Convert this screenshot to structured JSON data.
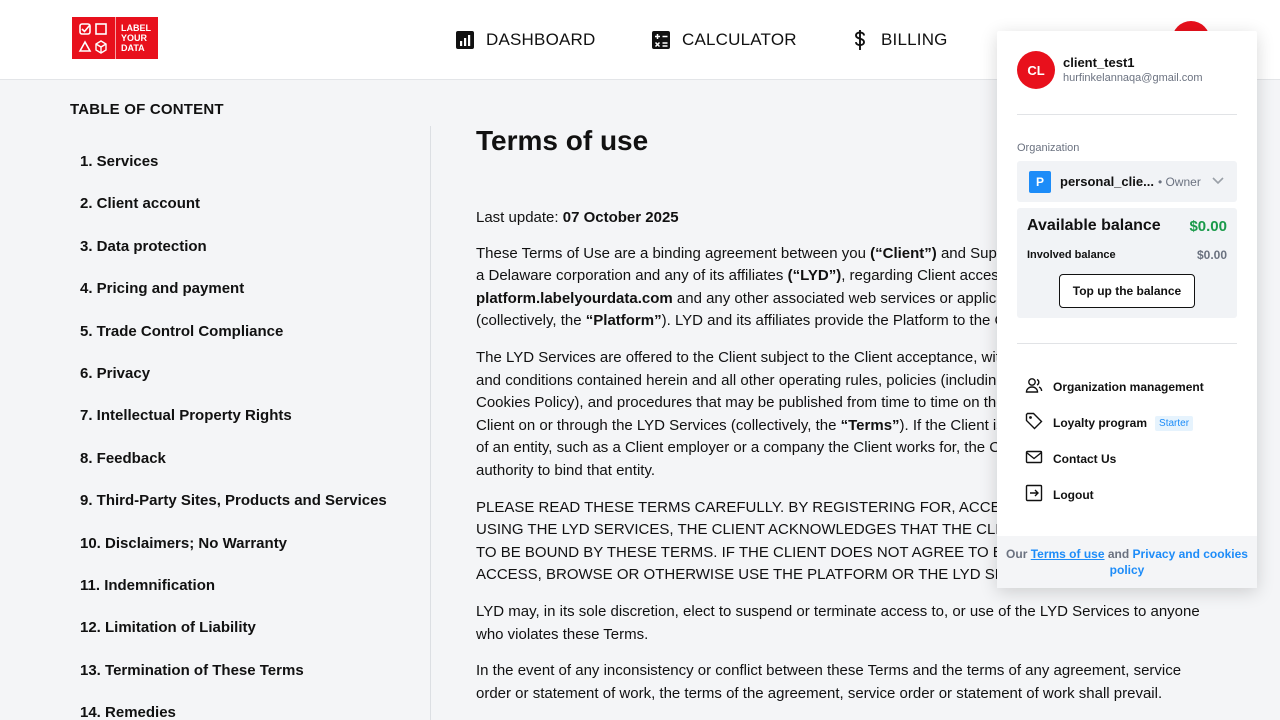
{
  "header": {
    "logo_text": [
      "LABEL",
      "YOUR",
      "DATA"
    ],
    "nav": [
      {
        "label": "DASHBOARD",
        "icon": "bar-chart-icon"
      },
      {
        "label": "CALCULATOR",
        "icon": "calculator-icon"
      },
      {
        "label": "BILLING",
        "icon": "dollar-icon"
      }
    ],
    "brand_color": "#e8101c"
  },
  "toc": {
    "title": "TABLE OF CONTENT",
    "items": [
      "1. Services",
      "2. Client account",
      "3. Data protection",
      "4. Pricing and payment",
      "5. Trade Control Compliance",
      "6. Privacy",
      "7. Intellectual Property Rights",
      "8. Feedback",
      "9. Third-Party Sites, Products and Services",
      "10. Disclaimers; No Warranty",
      "11. Indemnification",
      "12. Limitation of Liability",
      "13. Termination of These Terms",
      "14. Remedies"
    ]
  },
  "main": {
    "title": "Terms of use",
    "last_update_label": "Last update: ",
    "last_update_value": "07 October 2025",
    "p1": {
      "a": "These Terms of Use are a binding agreement between you ",
      "b": "(“Client”)",
      "c": " and SupportYo",
      "d": "a Delaware corporation and any of its affiliates ",
      "e": "(“LYD”)",
      "f": ", regarding Client access to a",
      "g": "platform.labelyourdata.com",
      "h": " and any other associated web services or applications",
      "i": "(collectively, the ",
      "j": "“Platform”",
      "k": "). LYD and its affiliates provide the Platform to the Clien"
    },
    "p2": {
      "a": "The LYD Services are offered to the Client subject to the Client acceptance, without",
      "b": "and conditions contained herein and all other operating rules, policies (including, w",
      "c": "Cookies Policy), and procedures that may be published from time to time on the Pla",
      "d": "Client on or through the LYD Services (collectively, the ",
      "e": "“Terms”",
      "f": "). If the Client is ente",
      "g": "of an entity, such as a Client employer or a company the Client works for, the Client",
      "h": "authority to bind that entity."
    },
    "p3": [
      "PLEASE READ THESE TERMS CAREFULLY. BY REGISTERING FOR, ACCESSING, BROW",
      "USING THE LYD SERVICES, THE CLIENT ACKNOWLEDGES THAT THE CLIENT HAS R",
      "TO BE BOUND BY THESE TERMS. IF THE CLIENT DOES NOT AGREE TO BE BOUND B",
      "ACCESS, BROWSE OR OTHERWISE USE THE PLATFORM OR THE LYD SERVICES."
    ],
    "p4": "LYD may, in its sole discretion, elect to suspend or terminate access to, or use of the LYD Services to anyone who violates these Terms.",
    "p5": "In the event of any inconsistency or conflict between these Terms and the terms of any agreement, service order or statement of work, the terms of the agreement, service order or statement of work shall prevail."
  },
  "dropdown": {
    "avatar_initials": "CL",
    "user_name": "client_test1",
    "user_email": "hurfinkelannaqa@gmail.com",
    "org_label": "Organization",
    "org_badge": "P",
    "org_name": "personal_clie...",
    "org_role": "• Owner",
    "available_balance_label": "Available balance",
    "available_balance_value": "$0.00",
    "involved_balance_label": "Involved balance",
    "involved_balance_value": "$0.00",
    "topup_label": "Top up the balance",
    "menu": [
      {
        "label": "Organization management",
        "icon": "users-icon"
      },
      {
        "label": "Loyalty program",
        "icon": "tag-icon",
        "badge": "Starter"
      },
      {
        "label": "Contact Us",
        "icon": "mail-icon"
      },
      {
        "label": "Logout",
        "icon": "logout-icon"
      }
    ],
    "footer": {
      "prefix": "Our ",
      "terms": "Terms of use",
      "and": " and ",
      "privacy": "Privacy and cookies policy"
    },
    "positive_color": "#1a9a4a",
    "link_color": "#1d8cf8"
  }
}
